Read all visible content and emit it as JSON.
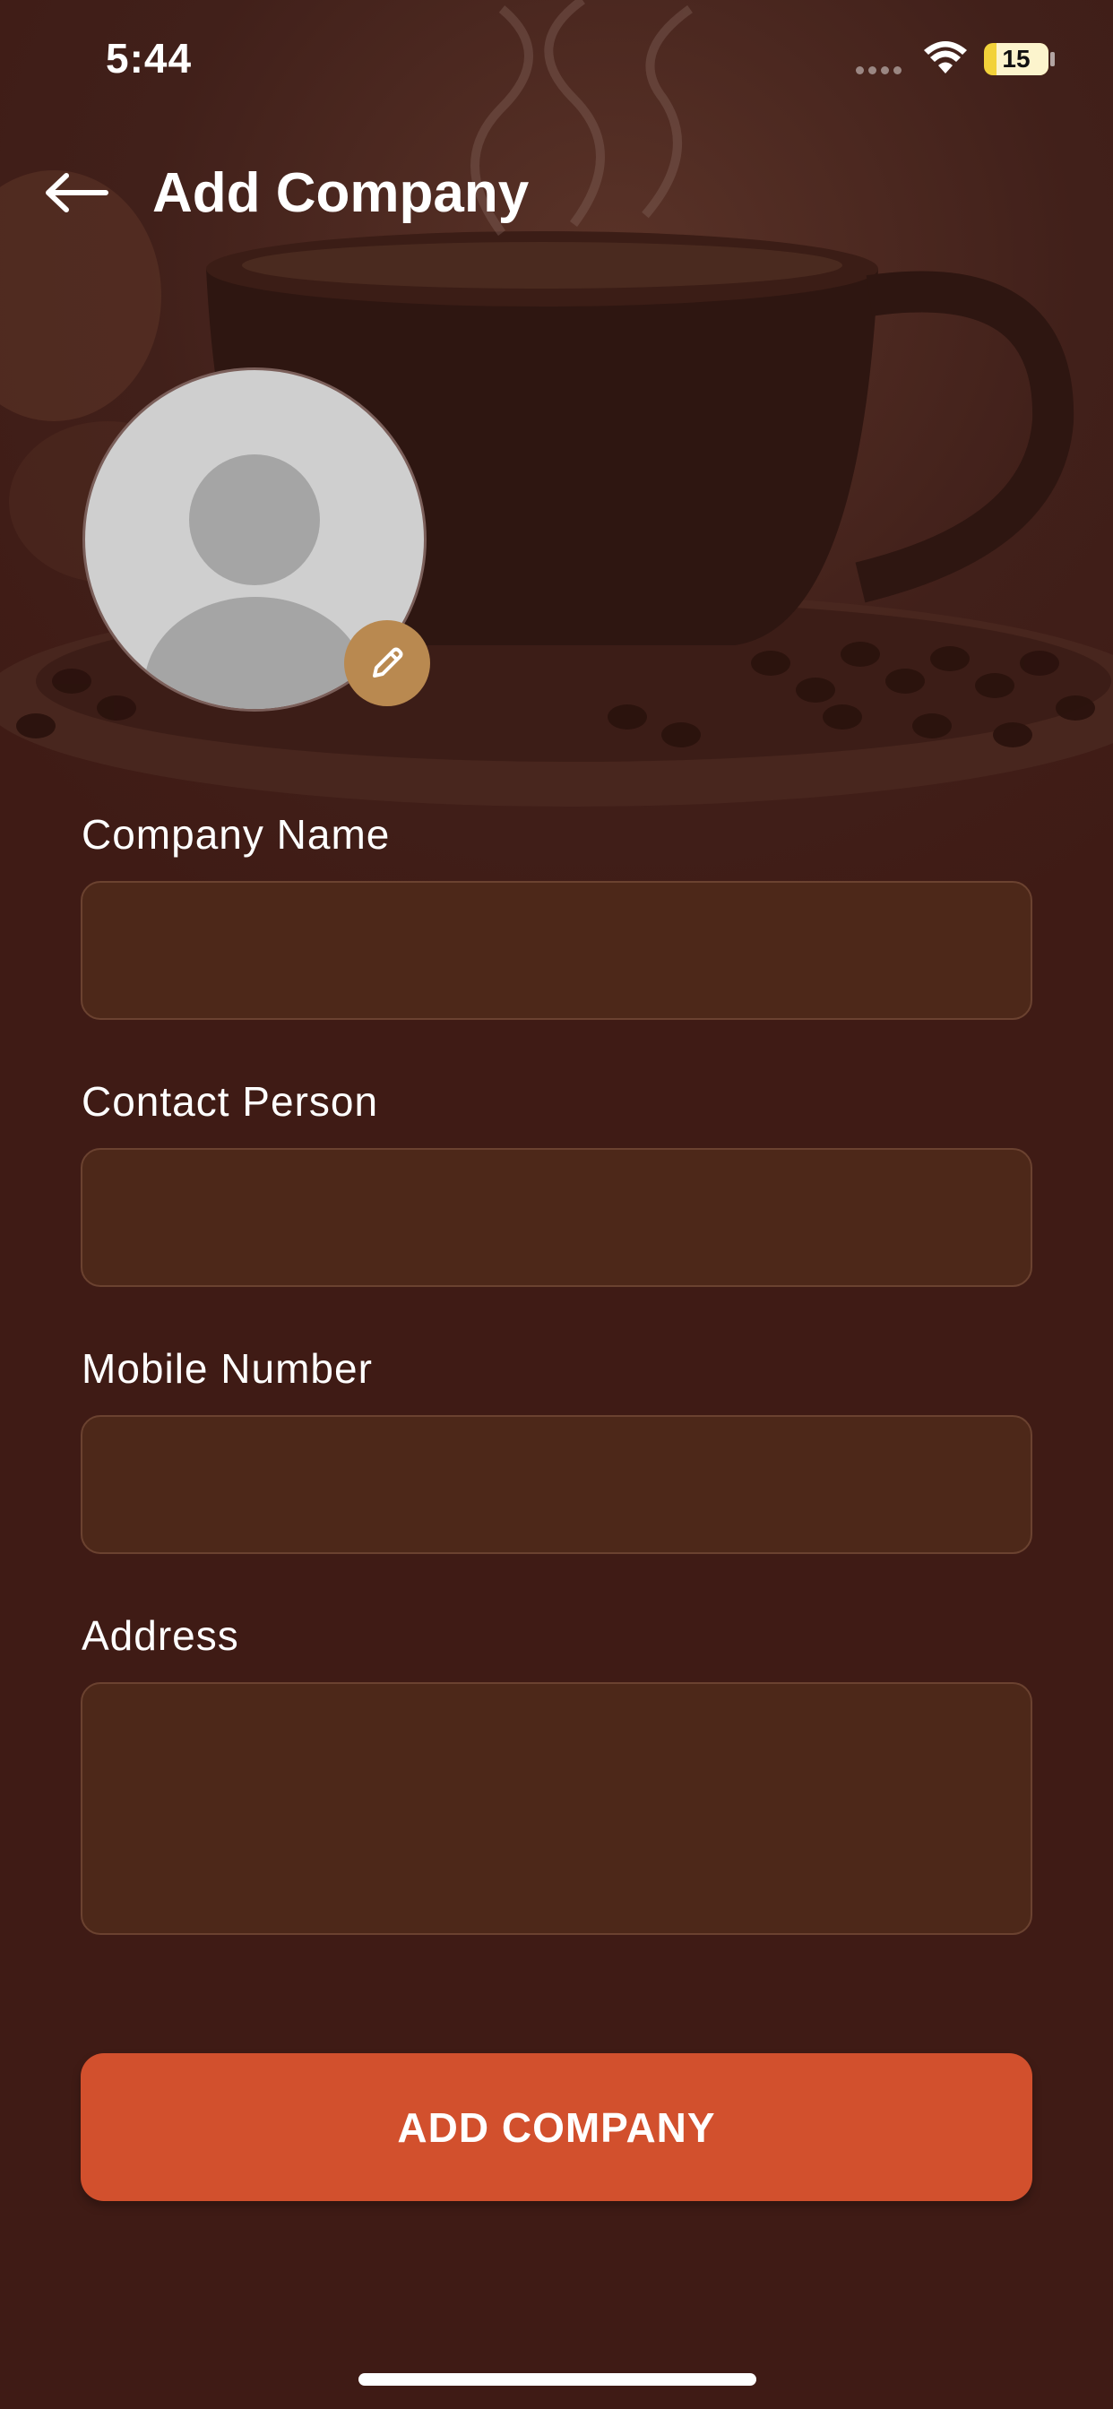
{
  "status_bar": {
    "time": "5:44",
    "battery": "15"
  },
  "header": {
    "title": "Add Company"
  },
  "form": {
    "company_name": {
      "label": "Company Name",
      "value": ""
    },
    "contact_person": {
      "label": "Contact Person",
      "value": ""
    },
    "mobile_number": {
      "label": "Mobile Number",
      "value": ""
    },
    "address": {
      "label": "Address",
      "value": ""
    }
  },
  "submit": {
    "label": "ADD COMPANY"
  },
  "colors": {
    "background": "#3f1b15",
    "field_fill": "#4d2819",
    "button": "#d2502d",
    "edit_badge": "#b98950"
  },
  "icons": {
    "back": "arrow-left-icon",
    "edit": "pencil-icon",
    "wifi": "wifi-icon",
    "avatar": "person-placeholder-icon"
  }
}
